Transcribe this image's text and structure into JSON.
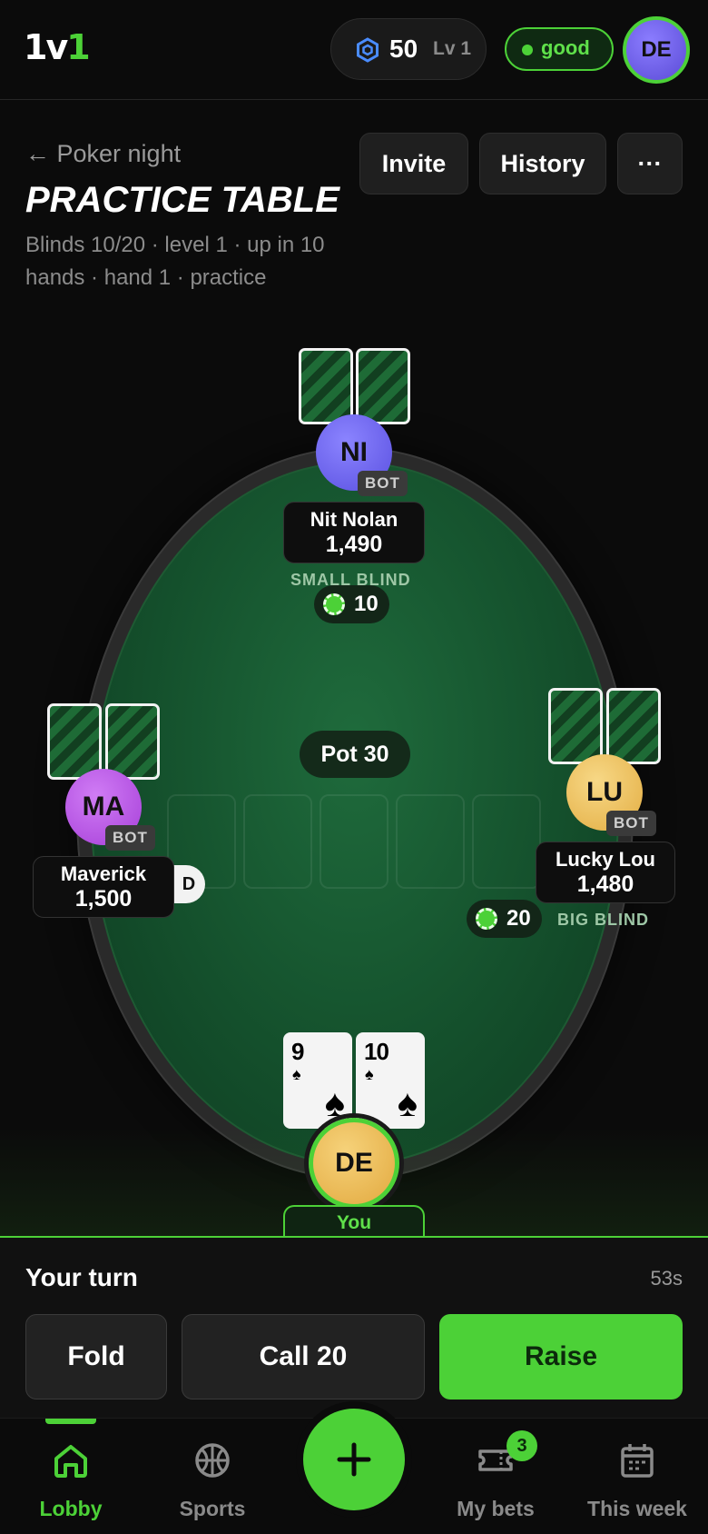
{
  "header": {
    "logo_part1": "1v",
    "logo_part2": "1",
    "coins": "50",
    "level": "Lv 1",
    "status": "good",
    "avatar_initials": "DE"
  },
  "title_area": {
    "back_label": "← Poker night",
    "title": "PRACTICE TABLE",
    "subtitle": "Blinds 10/20 · level 1 · up in 10 hands · hand 1 · practice",
    "buttons": {
      "invite": "Invite",
      "history": "History",
      "more": "···"
    }
  },
  "table": {
    "pot_label": "Pot 30",
    "dealer_label": "D",
    "players": {
      "top": {
        "initials": "NI",
        "name": "Nit Nolan",
        "stack": "1,490",
        "tag": "BOT",
        "role": "SMALL BLIND",
        "bet": "10",
        "color": "#6c63ff"
      },
      "left": {
        "initials": "MA",
        "name": "Maverick",
        "stack": "1,500",
        "tag": "BOT",
        "color": "#b54be0"
      },
      "right": {
        "initials": "LU",
        "name": "Lucky Lou",
        "stack": "1,480",
        "tag": "BOT",
        "role": "BIG BLIND",
        "bet": "20",
        "color": "#f0c24d"
      }
    },
    "hero": {
      "initials": "DE",
      "label": "You",
      "cards": [
        {
          "rank": "9",
          "suit": "♠"
        },
        {
          "rank": "10",
          "suit": "♠"
        }
      ]
    }
  },
  "actions": {
    "prompt": "Your turn",
    "timer": "53s",
    "fold": "Fold",
    "call": "Call 20",
    "raise": "Raise"
  },
  "nav": {
    "items": [
      {
        "label": "Lobby",
        "icon": "home-icon"
      },
      {
        "label": "Sports",
        "icon": "basketball-icon"
      },
      {
        "label": "My bets",
        "icon": "ticket-icon",
        "badge": "3"
      },
      {
        "label": "This week",
        "icon": "calendar-icon"
      }
    ],
    "fab_icon": "plus-icon"
  },
  "colors": {
    "accent": "#4cd137",
    "felt": "#16552f",
    "background": "#0b0b0b"
  }
}
